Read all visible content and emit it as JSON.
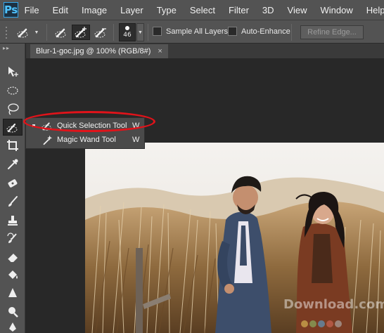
{
  "app": {
    "logo": "Ps"
  },
  "menu": [
    "File",
    "Edit",
    "Image",
    "Layer",
    "Type",
    "Select",
    "Filter",
    "3D",
    "View",
    "Window",
    "Help"
  ],
  "options": {
    "brush_size": "46",
    "sample_all_layers": "Sample All Layers",
    "auto_enhance": "Auto-Enhance",
    "refine_edge": "Refine Edge..."
  },
  "document": {
    "tab_title": "Blur-1-goc.jpg @ 100% (RGB/8#)",
    "close": "×"
  },
  "flyout": {
    "items": [
      {
        "label": "Quick Selection Tool",
        "shortcut": "W",
        "icon": "quick-selection-icon"
      },
      {
        "label": "Magic Wand Tool",
        "shortcut": "W",
        "icon": "magic-wand-icon"
      }
    ]
  },
  "colors": {
    "menubar": "#535353",
    "canvas_bg": "#282828",
    "highlight": "#e0131a",
    "ps_logo": "#4fc3ff"
  }
}
